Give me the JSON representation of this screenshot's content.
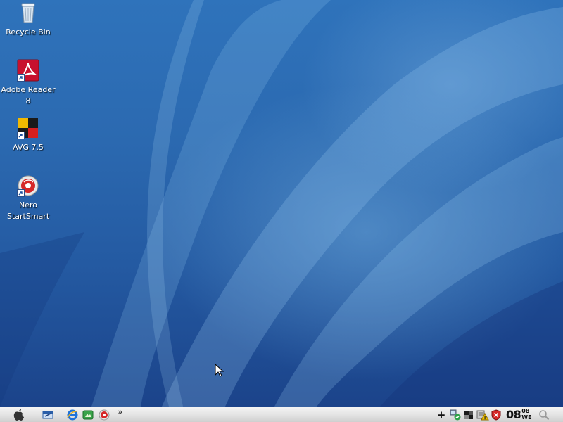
{
  "desktop": {
    "icons": [
      {
        "name": "recycle-bin",
        "label": "Recycle Bin"
      },
      {
        "name": "adobe-reader-8",
        "label": "Adobe Reader 8"
      },
      {
        "name": "avg-7-5",
        "label": "AVG 7.5"
      },
      {
        "name": "nero-startsmart",
        "label": "Nero StartSmart"
      }
    ]
  },
  "taskbar": {
    "quicklaunch_overflow": "»",
    "tray_add": "+",
    "clock": {
      "hours": "08",
      "minutes": "08",
      "day": "WE"
    }
  },
  "colors": {
    "desktop_blue": "#2b69b0",
    "taskbar_gray": "#e4e4e4",
    "adobe_red": "#c8102e",
    "nero_red": "#d62828"
  },
  "icon_names": {
    "start": "apple-icon",
    "quicklaunch": [
      "show-desktop-icon",
      "internet-explorer-icon",
      "media-icon",
      "nero-icon"
    ],
    "tray": [
      "network-icon",
      "avg-tray-icon",
      "security-alert-icon",
      "shield-icon",
      "search-icon"
    ]
  }
}
